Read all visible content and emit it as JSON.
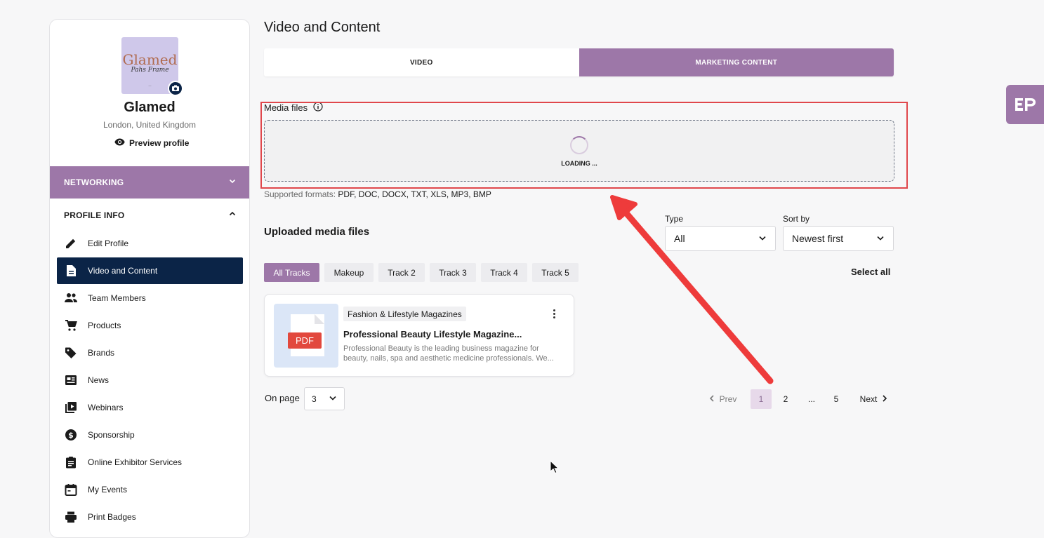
{
  "sidebar": {
    "logo_word": "Glamed",
    "logo_signature": "Pahs Frame",
    "company_name": "Glamed",
    "location": "London, United Kingdom",
    "preview_label": "Preview profile",
    "section_networking": "NETWORKING",
    "section_profile": "PROFILE INFO",
    "items": [
      {
        "label": "Edit Profile",
        "icon": "pencil-icon"
      },
      {
        "label": "Video and Content",
        "icon": "document-icon",
        "active": true
      },
      {
        "label": "Team Members",
        "icon": "people-icon"
      },
      {
        "label": "Products",
        "icon": "cart-icon"
      },
      {
        "label": "Brands",
        "icon": "tag-icon"
      },
      {
        "label": "News",
        "icon": "newspaper-icon"
      },
      {
        "label": "Webinars",
        "icon": "video-library-icon"
      },
      {
        "label": "Sponsorship",
        "icon": "dollar-coin-icon"
      },
      {
        "label": "Online Exhibitor Services",
        "icon": "clipboard-icon"
      },
      {
        "label": "My Events",
        "icon": "calendar-icon"
      },
      {
        "label": "Print Badges",
        "icon": "printer-icon"
      }
    ]
  },
  "main": {
    "title": "Video and Content",
    "tabs": [
      {
        "label": "VIDEO",
        "active": false
      },
      {
        "label": "MARKETING CONTENT",
        "active": true
      }
    ],
    "media_files_label": "Media files",
    "loading_text": "LOADING ...",
    "supported_formats_label": "Supported formats:",
    "supported_formats_value": "PDF, DOC, DOCX, TXT, XLS, MP3, BMP",
    "uploaded_title": "Uploaded media files",
    "type_label": "Type",
    "type_value": "All",
    "sort_label": "Sort by",
    "sort_value": "Newest first",
    "tracks": [
      "All Tracks",
      "Makeup",
      "Track 2",
      "Track 3",
      "Track 4",
      "Track 5"
    ],
    "select_all": "Select all",
    "card": {
      "tag": "Fashion & Lifestyle Magazines",
      "title": "Professional Beauty  Lifestyle Magazine...",
      "description": "Professional Beauty is the leading business magazine for beauty, nails, spa and aesthetic medicine professionals. We...",
      "file_type": "PDF"
    },
    "on_page_label": "On page",
    "on_page_value": "3",
    "pagination": {
      "prev": "Prev",
      "next": "Next",
      "pages": [
        "1",
        "2",
        "...",
        "5"
      ],
      "current": "1"
    }
  },
  "floating_badge": "EP",
  "colors": {
    "accent": "#9d77a8",
    "navy": "#0b2447",
    "highlight": "#e0474c"
  }
}
